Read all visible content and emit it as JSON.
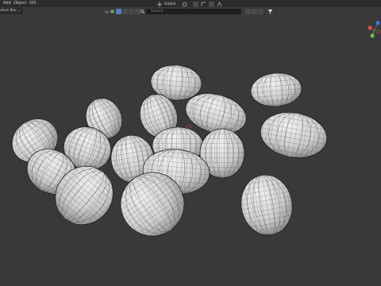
{
  "menubar": {
    "items": [
      "Add",
      "Object",
      "GIS"
    ]
  },
  "header": {
    "select_box_label": "elect Box ⌄",
    "search_placeholder": "Search",
    "transform_orientation": "Global",
    "icon_names": [
      "view-dropdown-icon",
      "object-mode-icon",
      "select-icon",
      "link-icon",
      "restrict-icon",
      "cursor-icon",
      "filter-icon",
      "snap-icon",
      "proportional-icon",
      "overlay-icon"
    ]
  },
  "colors": {
    "background": "#393939",
    "mesh_light": "#d9d9d9",
    "mesh_wire": "#2f2f2f",
    "gizmo_x": "#e24a4a",
    "gizmo_y": "#6cbf3f",
    "gizmo_z": "#3d7bd6"
  }
}
